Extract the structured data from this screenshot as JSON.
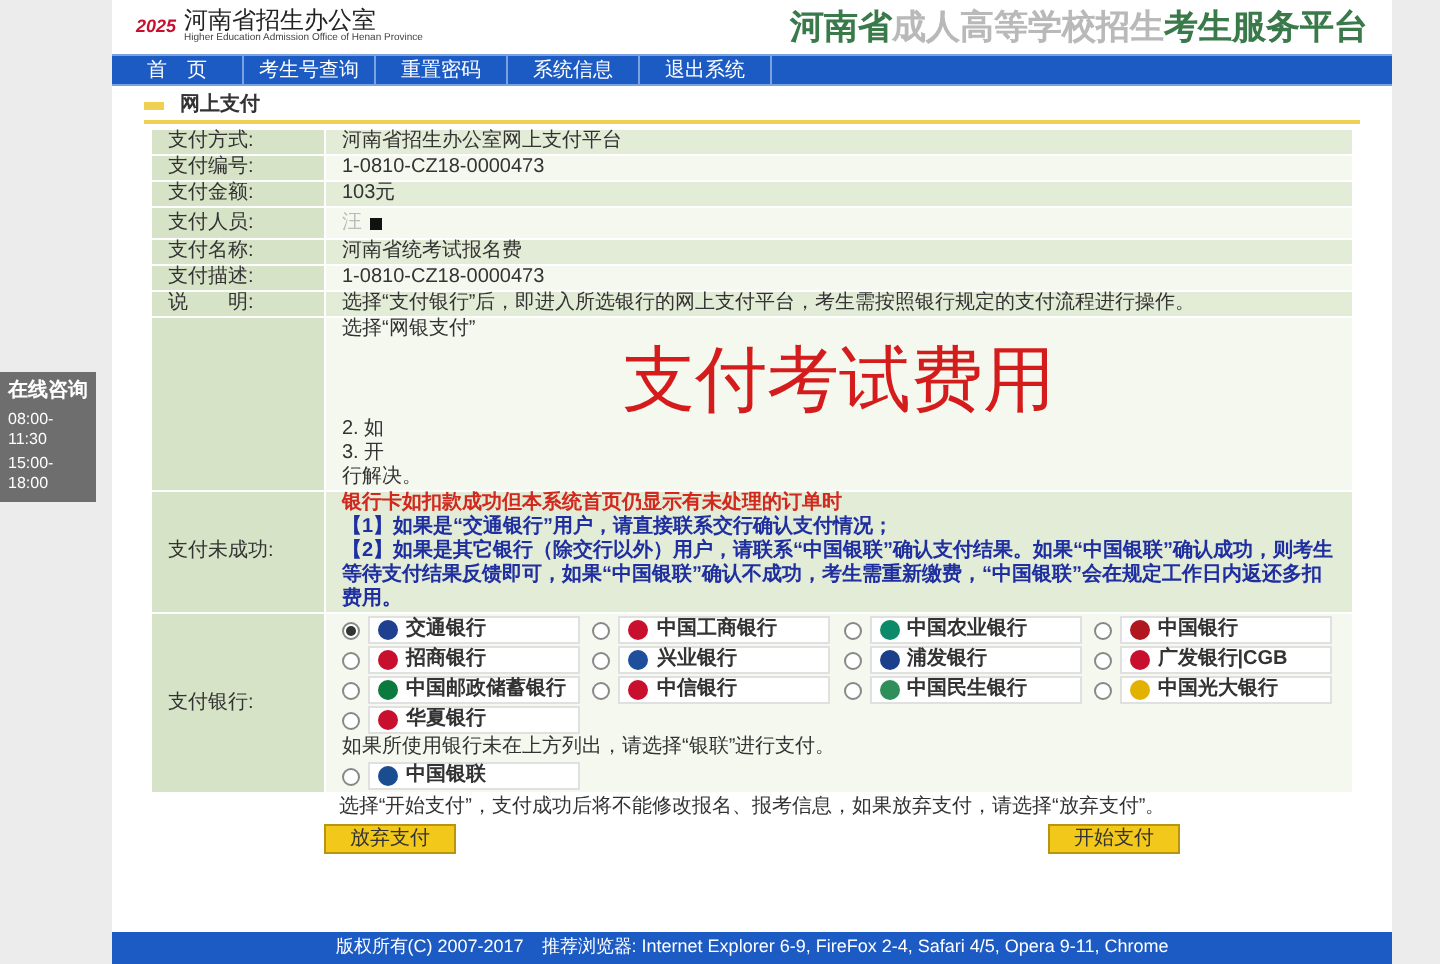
{
  "consult_box": {
    "title": "在线咨询",
    "hours": [
      "08:00-11:30",
      "15:00-18:00"
    ]
  },
  "header": {
    "logo_mark": "2025",
    "org_name": "河南省招生办公室",
    "org_name_en": "Higher Education Admission Office of Henan Province",
    "platform_title_parts": [
      {
        "text": "河南省",
        "kind": "strong"
      },
      {
        "text": "成人高等学校招生",
        "kind": "faded"
      },
      {
        "text": "考生服务平台",
        "kind": "strong"
      }
    ]
  },
  "nav": [
    {
      "label": "首　页",
      "selected": false
    },
    {
      "label": "考生号查询",
      "selected": false
    },
    {
      "label": "重置密码",
      "selected": false
    },
    {
      "label": "系统信息",
      "selected": false
    },
    {
      "label": "退出系统",
      "selected": false
    }
  ],
  "section_title": "网上支付",
  "info_rows": [
    {
      "label": "支付方式:",
      "value": "河南省招生办公室网上支付平台",
      "kind": "text"
    },
    {
      "label": "支付编号:",
      "value": "1-0810-CZ18-0000473",
      "kind": "text"
    },
    {
      "label": "支付金额:",
      "value": "103元",
      "kind": "text"
    },
    {
      "label": "支付人员:",
      "value": "汪",
      "kind": "redacted"
    },
    {
      "label": "支付名称:",
      "value": "河南省统考试报名费",
      "kind": "text"
    },
    {
      "label": "支付描述:",
      "value": "1-0810-CZ18-0000473",
      "kind": "text"
    },
    {
      "label": "说　　明:",
      "value": "选择“支付银行”后，即进入所选银行的网上支付平台，考生需按照银行规定的支付流程进行操作。",
      "kind": "text"
    }
  ],
  "notes_fragments": [
    "选择“网银支付”",
    "2. 如",
    "3. 开",
    "行解决。"
  ],
  "overlay_caption": "支付考试费用",
  "failure_row": {
    "label": "支付未成功:",
    "heading": "银行卡如扣款成功但本系统首页仍显示有未处理的订单时",
    "lines": [
      "【1】如果是“交通银行”用户，请直接联系交行确认支付情况；",
      "【2】如果是其它银行（除交行以外）用户，请联系“中国银联”确认支付结果。如果“中国银联”确认成功，则考生等待支付结果反馈即可，如果“中国银联”确认不成功，考生需重新缴费，“中国银联”会在规定工作日内返还多扣费用。"
    ]
  },
  "bank_row": {
    "label": "支付银行:",
    "banks": [
      {
        "name": "交通银行",
        "color": "#1f3f8f",
        "selected": true
      },
      {
        "name": "中国工商银行",
        "color": "#c8102e",
        "selected": false
      },
      {
        "name": "中国农业银行",
        "color": "#0d8a6a",
        "selected": false
      },
      {
        "name": "中国银行",
        "color": "#b0171f",
        "selected": false
      },
      {
        "name": "招商银行",
        "color": "#c8102e",
        "selected": false
      },
      {
        "name": "兴业银行",
        "color": "#1d4f9c",
        "selected": false
      },
      {
        "name": "浦发银行",
        "color": "#1b3f8b",
        "selected": false
      },
      {
        "name": "广发银行|CGB",
        "color": "#c8102e",
        "selected": false
      },
      {
        "name": "中国邮政储蓄银行",
        "color": "#0b7a3e",
        "selected": false
      },
      {
        "name": "中信银行",
        "color": "#c8102e",
        "selected": false
      },
      {
        "name": "中国民生银行",
        "color": "#2f8f5b",
        "selected": false
      },
      {
        "name": "中国光大银行",
        "color": "#e3b100",
        "selected": false
      },
      {
        "name": "华夏银行",
        "color": "#c8102e",
        "selected": false
      }
    ],
    "other_note": "如果所使用银行未在上方列出，请选择“银联”进行支付。",
    "unionpay": {
      "name": "中国银联",
      "color": "#1a4d8f",
      "selected": false
    }
  },
  "bottom_note": "选择“开始支付”，支付成功后将不能修改报名、报考信息，如果放弃支付，请选择“放弃支付”。",
  "buttons": [
    {
      "label": "放弃支付"
    },
    {
      "label": "开始支付"
    }
  ],
  "footer": "版权所有(C) 2007-2017　推荐浏览器: Internet Explorer 6-9, FireFox 2-4, Safari 4/5, Opera 9-11, Chrome"
}
